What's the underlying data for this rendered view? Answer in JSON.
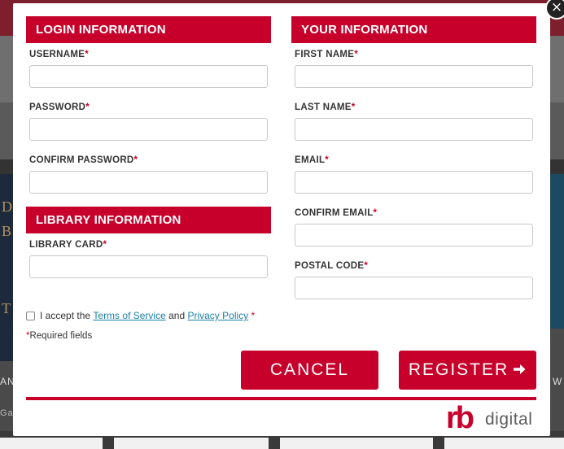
{
  "background": {
    "left_book_letters": [
      "D",
      "B",
      "T"
    ],
    "side_text_left": "AN",
    "side_text_right": "W",
    "side_text_bottom_left": "Ga"
  },
  "modal": {
    "close_glyph": "×",
    "login_section": {
      "title": "LOGIN INFORMATION",
      "fields": [
        {
          "label": "USERNAME",
          "required": "*",
          "value": ""
        },
        {
          "label": "PASSWORD",
          "required": "*",
          "value": ""
        },
        {
          "label": "CONFIRM PASSWORD",
          "required": "*",
          "value": ""
        }
      ]
    },
    "library_section": {
      "title": "LIBRARY INFORMATION",
      "fields": [
        {
          "label": "LIBRARY CARD",
          "required": "*",
          "value": ""
        }
      ]
    },
    "your_section": {
      "title": "YOUR INFORMATION",
      "fields": [
        {
          "label": "FIRST NAME",
          "required": "*",
          "value": ""
        },
        {
          "label": "LAST NAME",
          "required": "*",
          "value": ""
        },
        {
          "label": "EMAIL",
          "required": "*",
          "value": ""
        },
        {
          "label": "CONFIRM EMAIL",
          "required": "*",
          "value": ""
        },
        {
          "label": "POSTAL CODE",
          "required": "*",
          "value": ""
        }
      ]
    },
    "terms": {
      "prefix": "I accept the ",
      "terms_link": "Terms of Service ",
      "middle": "and ",
      "privacy_link": "Privacy Policy ",
      "required": "*"
    },
    "required_note": {
      "mark": "*",
      "text": "Required fields"
    },
    "cancel_label": "CANCEL",
    "register_label": "REGISTER",
    "logo": {
      "rb": "rb",
      "digital": "digital"
    }
  },
  "colors": {
    "accent": "#c6002b",
    "link": "#1a7fa8"
  },
  "icons": {
    "register_arrow": "arrow-right-icon",
    "close": "close-icon",
    "checkbox": "checkbox-icon"
  }
}
